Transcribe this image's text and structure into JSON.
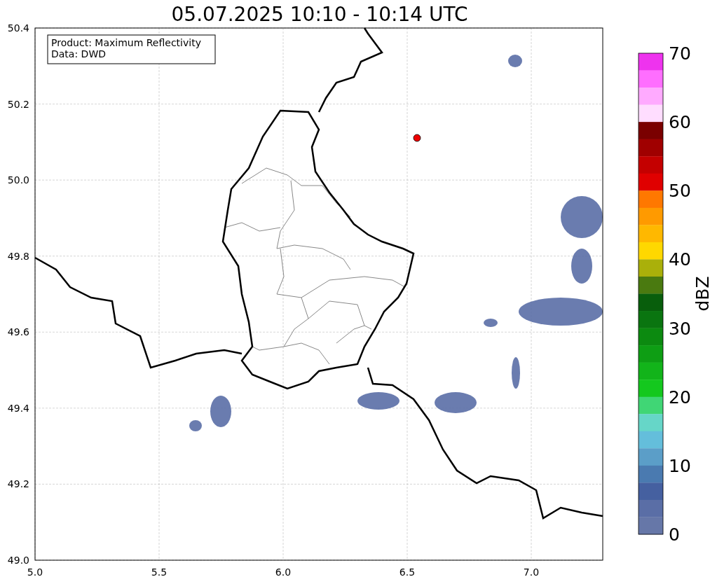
{
  "title": "05.07.2025 10:10 - 10:14 UTC",
  "map": {
    "info_lines": [
      "Product: Maximum Reflectivity",
      "Data: DWD"
    ],
    "xticks": [
      "5.0",
      "5.5",
      "6.0",
      "6.5",
      "7.0"
    ],
    "yticks": [
      "50.4",
      "50.2",
      "50.0",
      "49.8",
      "49.6",
      "49.4",
      "49.2",
      "49.0"
    ]
  },
  "colorbar": {
    "label": "dBZ",
    "ticks": [
      "70",
      "60",
      "50",
      "40",
      "30",
      "20",
      "10",
      "0"
    ],
    "segments": [
      {
        "color": "#ee33ee"
      },
      {
        "color": "#ff6eff"
      },
      {
        "color": "#ffaaff"
      },
      {
        "color": "#ffddff"
      },
      {
        "color": "#7a0000"
      },
      {
        "color": "#a00000"
      },
      {
        "color": "#c40000"
      },
      {
        "color": "#e00000"
      },
      {
        "color": "#ff7800"
      },
      {
        "color": "#ff9a00"
      },
      {
        "color": "#ffb800"
      },
      {
        "color": "#ffd800"
      },
      {
        "color": "#aab00a"
      },
      {
        "color": "#4a7a10"
      },
      {
        "color": "#085e0c"
      },
      {
        "color": "#0a7510"
      },
      {
        "color": "#0c8a10"
      },
      {
        "color": "#0e9e14"
      },
      {
        "color": "#12b41a"
      },
      {
        "color": "#14c81e"
      },
      {
        "color": "#40d675"
      },
      {
        "color": "#66d6c8"
      },
      {
        "color": "#64bedb"
      },
      {
        "color": "#5b9ec8"
      },
      {
        "color": "#4a7ab0"
      },
      {
        "color": "#4560a0"
      },
      {
        "color": "#5a6ea6"
      },
      {
        "color": "#6677a8"
      }
    ]
  }
}
